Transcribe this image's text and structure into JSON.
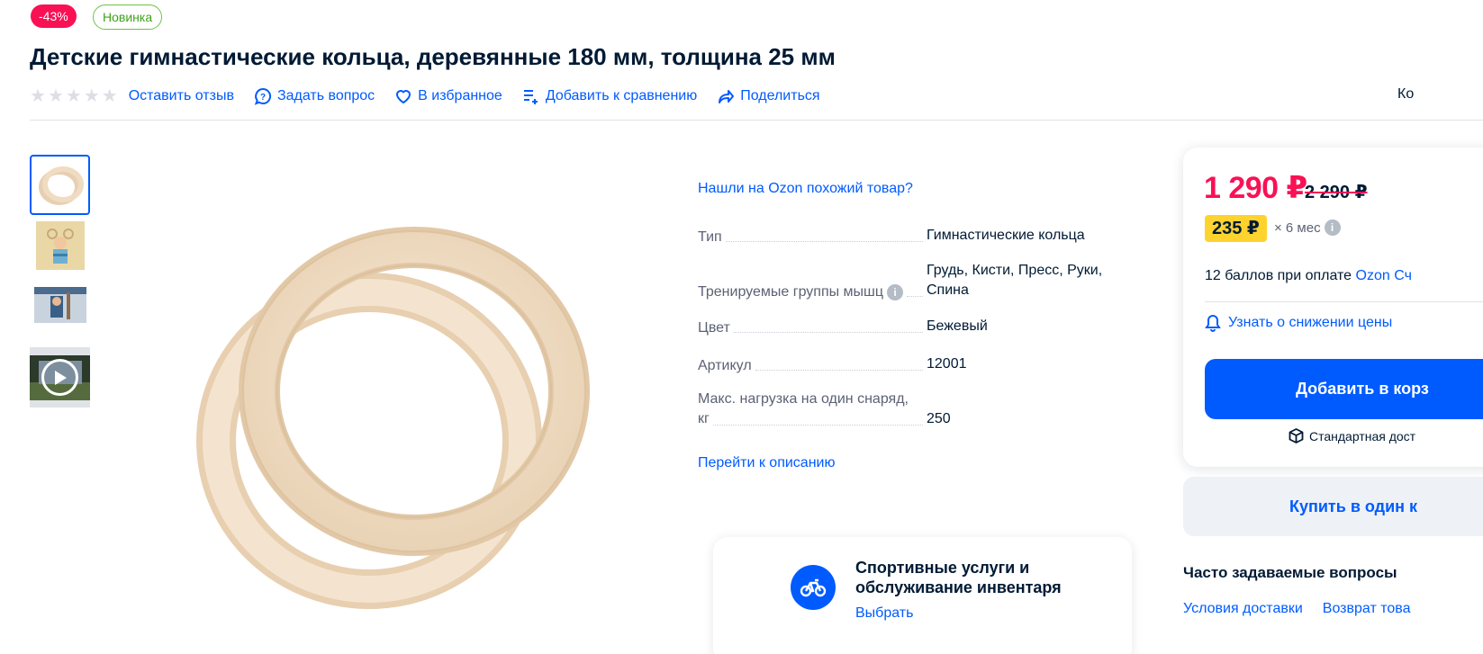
{
  "badges": {
    "discount": "-43%",
    "new": "Новинка"
  },
  "product": {
    "title": "Детские гимнастические кольца, деревянные 180 мм, толщина 25 мм"
  },
  "actions": {
    "review": "Оставить отзыв",
    "question": "Задать вопрос",
    "favorite": "В избранное",
    "compare": "Добавить к сравнению",
    "share": "Поделиться",
    "truncated": "Ко"
  },
  "rating": {
    "stars": 0,
    "max": 5
  },
  "gallery": {
    "thumbnails": [
      "ring-photo",
      "child-on-rings-photo",
      "child-hanging-photo",
      "video-thumbnail"
    ]
  },
  "specs": {
    "similar_link": "Нашли на Ozon похожий товар?",
    "rows": [
      {
        "key": "Тип",
        "value": "Гимнастические кольца"
      },
      {
        "key": "Тренируемые группы мышц",
        "value": "Грудь, Кисти, Пресс, Руки, Спина"
      },
      {
        "key": "Цвет",
        "value": "Бежевый"
      },
      {
        "key": "Артикул",
        "value": "12001"
      },
      {
        "key_line1": "Макс. нагрузка на один снаряд,",
        "key_line2": "кг",
        "value": "250"
      }
    ],
    "goto_description": "Перейти к описанию"
  },
  "promo": {
    "title": "Спортивные услуги и обслуживание инвентаря",
    "link": "Выбрать"
  },
  "price": {
    "current": "1 290 ₽",
    "old": "2 290 ₽",
    "installment": "235 ₽",
    "installment_months": "× 6 мес",
    "points": "12 баллов при оплате ",
    "points_link": "Ozon Сч",
    "notify": "Узнать о снижении цены",
    "add_to_cart": "Добавить в корз",
    "delivery": "Стандартная дост",
    "buy_one_click": "Купить в один к"
  },
  "faq": {
    "title": "Часто задаваемые вопросы",
    "links": [
      "Условия доставки",
      "Возврат това"
    ]
  },
  "colors": {
    "accent": "#005bff",
    "sale": "#f91155",
    "installment": "#ffd32e",
    "new": "#3fa31a"
  }
}
